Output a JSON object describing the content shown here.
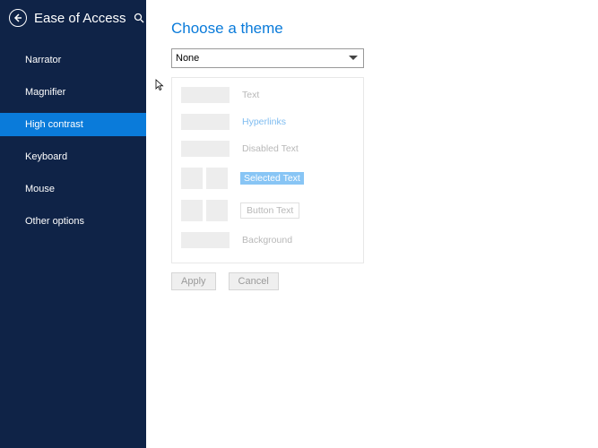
{
  "sidebar": {
    "title": "Ease of Access",
    "items": [
      {
        "label": "Narrator",
        "selected": false
      },
      {
        "label": "Magnifier",
        "selected": false
      },
      {
        "label": "High contrast",
        "selected": true
      },
      {
        "label": "Keyboard",
        "selected": false
      },
      {
        "label": "Mouse",
        "selected": false
      },
      {
        "label": "Other options",
        "selected": false
      }
    ]
  },
  "main": {
    "title": "Choose a theme",
    "theme_select": {
      "value": "None",
      "options": [
        "None"
      ]
    },
    "preview": {
      "text_label": "Text",
      "hyperlinks_label": "Hyperlinks",
      "disabled_text_label": "Disabled Text",
      "selected_text_label": "Selected Text",
      "button_text_label": "Button Text",
      "background_label": "Background"
    },
    "actions": {
      "apply_label": "Apply",
      "cancel_label": "Cancel"
    }
  },
  "colors": {
    "sidebar_bg": "#0f2347",
    "accent": "#0a7bda"
  }
}
